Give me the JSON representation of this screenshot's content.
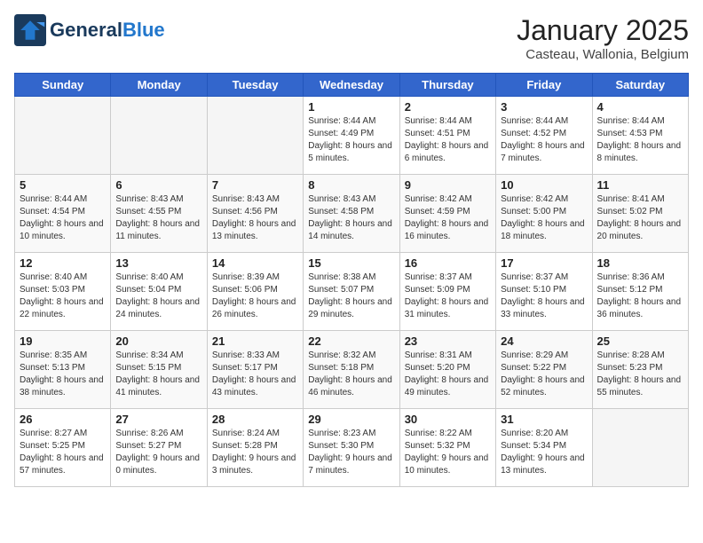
{
  "header": {
    "logo_text_general": "General",
    "logo_text_blue": "Blue",
    "month_title": "January 2025",
    "subtitle": "Casteau, Wallonia, Belgium"
  },
  "days_of_week": [
    "Sunday",
    "Monday",
    "Tuesday",
    "Wednesday",
    "Thursday",
    "Friday",
    "Saturday"
  ],
  "weeks": [
    [
      {
        "day": "",
        "empty": true
      },
      {
        "day": "",
        "empty": true
      },
      {
        "day": "",
        "empty": true
      },
      {
        "day": "1",
        "sunrise": "Sunrise: 8:44 AM",
        "sunset": "Sunset: 4:49 PM",
        "daylight": "Daylight: 8 hours and 5 minutes."
      },
      {
        "day": "2",
        "sunrise": "Sunrise: 8:44 AM",
        "sunset": "Sunset: 4:51 PM",
        "daylight": "Daylight: 8 hours and 6 minutes."
      },
      {
        "day": "3",
        "sunrise": "Sunrise: 8:44 AM",
        "sunset": "Sunset: 4:52 PM",
        "daylight": "Daylight: 8 hours and 7 minutes."
      },
      {
        "day": "4",
        "sunrise": "Sunrise: 8:44 AM",
        "sunset": "Sunset: 4:53 PM",
        "daylight": "Daylight: 8 hours and 8 minutes."
      }
    ],
    [
      {
        "day": "5",
        "sunrise": "Sunrise: 8:44 AM",
        "sunset": "Sunset: 4:54 PM",
        "daylight": "Daylight: 8 hours and 10 minutes."
      },
      {
        "day": "6",
        "sunrise": "Sunrise: 8:43 AM",
        "sunset": "Sunset: 4:55 PM",
        "daylight": "Daylight: 8 hours and 11 minutes."
      },
      {
        "day": "7",
        "sunrise": "Sunrise: 8:43 AM",
        "sunset": "Sunset: 4:56 PM",
        "daylight": "Daylight: 8 hours and 13 minutes."
      },
      {
        "day": "8",
        "sunrise": "Sunrise: 8:43 AM",
        "sunset": "Sunset: 4:58 PM",
        "daylight": "Daylight: 8 hours and 14 minutes."
      },
      {
        "day": "9",
        "sunrise": "Sunrise: 8:42 AM",
        "sunset": "Sunset: 4:59 PM",
        "daylight": "Daylight: 8 hours and 16 minutes."
      },
      {
        "day": "10",
        "sunrise": "Sunrise: 8:42 AM",
        "sunset": "Sunset: 5:00 PM",
        "daylight": "Daylight: 8 hours and 18 minutes."
      },
      {
        "day": "11",
        "sunrise": "Sunrise: 8:41 AM",
        "sunset": "Sunset: 5:02 PM",
        "daylight": "Daylight: 8 hours and 20 minutes."
      }
    ],
    [
      {
        "day": "12",
        "sunrise": "Sunrise: 8:40 AM",
        "sunset": "Sunset: 5:03 PM",
        "daylight": "Daylight: 8 hours and 22 minutes."
      },
      {
        "day": "13",
        "sunrise": "Sunrise: 8:40 AM",
        "sunset": "Sunset: 5:04 PM",
        "daylight": "Daylight: 8 hours and 24 minutes."
      },
      {
        "day": "14",
        "sunrise": "Sunrise: 8:39 AM",
        "sunset": "Sunset: 5:06 PM",
        "daylight": "Daylight: 8 hours and 26 minutes."
      },
      {
        "day": "15",
        "sunrise": "Sunrise: 8:38 AM",
        "sunset": "Sunset: 5:07 PM",
        "daylight": "Daylight: 8 hours and 29 minutes."
      },
      {
        "day": "16",
        "sunrise": "Sunrise: 8:37 AM",
        "sunset": "Sunset: 5:09 PM",
        "daylight": "Daylight: 8 hours and 31 minutes."
      },
      {
        "day": "17",
        "sunrise": "Sunrise: 8:37 AM",
        "sunset": "Sunset: 5:10 PM",
        "daylight": "Daylight: 8 hours and 33 minutes."
      },
      {
        "day": "18",
        "sunrise": "Sunrise: 8:36 AM",
        "sunset": "Sunset: 5:12 PM",
        "daylight": "Daylight: 8 hours and 36 minutes."
      }
    ],
    [
      {
        "day": "19",
        "sunrise": "Sunrise: 8:35 AM",
        "sunset": "Sunset: 5:13 PM",
        "daylight": "Daylight: 8 hours and 38 minutes."
      },
      {
        "day": "20",
        "sunrise": "Sunrise: 8:34 AM",
        "sunset": "Sunset: 5:15 PM",
        "daylight": "Daylight: 8 hours and 41 minutes."
      },
      {
        "day": "21",
        "sunrise": "Sunrise: 8:33 AM",
        "sunset": "Sunset: 5:17 PM",
        "daylight": "Daylight: 8 hours and 43 minutes."
      },
      {
        "day": "22",
        "sunrise": "Sunrise: 8:32 AM",
        "sunset": "Sunset: 5:18 PM",
        "daylight": "Daylight: 8 hours and 46 minutes."
      },
      {
        "day": "23",
        "sunrise": "Sunrise: 8:31 AM",
        "sunset": "Sunset: 5:20 PM",
        "daylight": "Daylight: 8 hours and 49 minutes."
      },
      {
        "day": "24",
        "sunrise": "Sunrise: 8:29 AM",
        "sunset": "Sunset: 5:22 PM",
        "daylight": "Daylight: 8 hours and 52 minutes."
      },
      {
        "day": "25",
        "sunrise": "Sunrise: 8:28 AM",
        "sunset": "Sunset: 5:23 PM",
        "daylight": "Daylight: 8 hours and 55 minutes."
      }
    ],
    [
      {
        "day": "26",
        "sunrise": "Sunrise: 8:27 AM",
        "sunset": "Sunset: 5:25 PM",
        "daylight": "Daylight: 8 hours and 57 minutes."
      },
      {
        "day": "27",
        "sunrise": "Sunrise: 8:26 AM",
        "sunset": "Sunset: 5:27 PM",
        "daylight": "Daylight: 9 hours and 0 minutes."
      },
      {
        "day": "28",
        "sunrise": "Sunrise: 8:24 AM",
        "sunset": "Sunset: 5:28 PM",
        "daylight": "Daylight: 9 hours and 3 minutes."
      },
      {
        "day": "29",
        "sunrise": "Sunrise: 8:23 AM",
        "sunset": "Sunset: 5:30 PM",
        "daylight": "Daylight: 9 hours and 7 minutes."
      },
      {
        "day": "30",
        "sunrise": "Sunrise: 8:22 AM",
        "sunset": "Sunset: 5:32 PM",
        "daylight": "Daylight: 9 hours and 10 minutes."
      },
      {
        "day": "31",
        "sunrise": "Sunrise: 8:20 AM",
        "sunset": "Sunset: 5:34 PM",
        "daylight": "Daylight: 9 hours and 13 minutes."
      },
      {
        "day": "",
        "empty": true
      }
    ]
  ]
}
